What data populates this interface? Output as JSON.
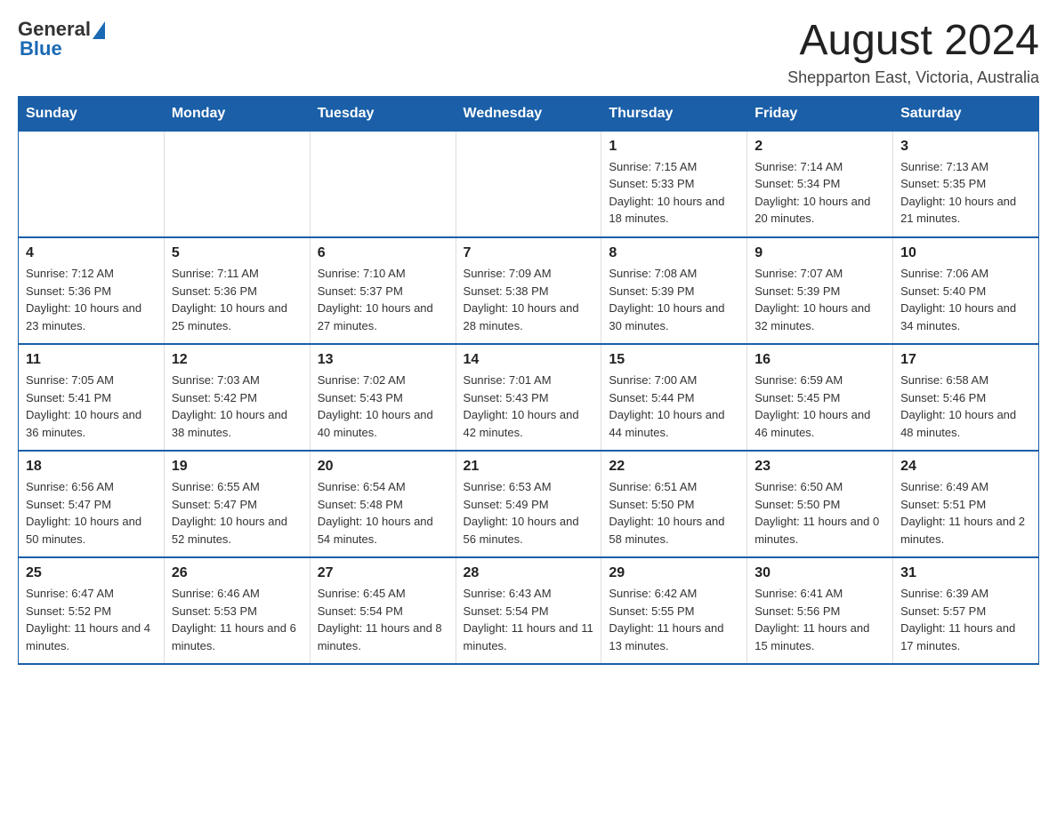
{
  "header": {
    "logo": {
      "text_general": "General",
      "text_blue": "Blue",
      "triangle_color": "#1a69b5"
    },
    "title": "August 2024",
    "location": "Shepparton East, Victoria, Australia"
  },
  "days_of_week": [
    "Sunday",
    "Monday",
    "Tuesday",
    "Wednesday",
    "Thursday",
    "Friday",
    "Saturday"
  ],
  "weeks": [
    {
      "days": [
        {
          "date": "",
          "info": ""
        },
        {
          "date": "",
          "info": ""
        },
        {
          "date": "",
          "info": ""
        },
        {
          "date": "",
          "info": ""
        },
        {
          "date": "1",
          "info": "Sunrise: 7:15 AM\nSunset: 5:33 PM\nDaylight: 10 hours and 18 minutes."
        },
        {
          "date": "2",
          "info": "Sunrise: 7:14 AM\nSunset: 5:34 PM\nDaylight: 10 hours and 20 minutes."
        },
        {
          "date": "3",
          "info": "Sunrise: 7:13 AM\nSunset: 5:35 PM\nDaylight: 10 hours and 21 minutes."
        }
      ]
    },
    {
      "days": [
        {
          "date": "4",
          "info": "Sunrise: 7:12 AM\nSunset: 5:36 PM\nDaylight: 10 hours and 23 minutes."
        },
        {
          "date": "5",
          "info": "Sunrise: 7:11 AM\nSunset: 5:36 PM\nDaylight: 10 hours and 25 minutes."
        },
        {
          "date": "6",
          "info": "Sunrise: 7:10 AM\nSunset: 5:37 PM\nDaylight: 10 hours and 27 minutes."
        },
        {
          "date": "7",
          "info": "Sunrise: 7:09 AM\nSunset: 5:38 PM\nDaylight: 10 hours and 28 minutes."
        },
        {
          "date": "8",
          "info": "Sunrise: 7:08 AM\nSunset: 5:39 PM\nDaylight: 10 hours and 30 minutes."
        },
        {
          "date": "9",
          "info": "Sunrise: 7:07 AM\nSunset: 5:39 PM\nDaylight: 10 hours and 32 minutes."
        },
        {
          "date": "10",
          "info": "Sunrise: 7:06 AM\nSunset: 5:40 PM\nDaylight: 10 hours and 34 minutes."
        }
      ]
    },
    {
      "days": [
        {
          "date": "11",
          "info": "Sunrise: 7:05 AM\nSunset: 5:41 PM\nDaylight: 10 hours and 36 minutes."
        },
        {
          "date": "12",
          "info": "Sunrise: 7:03 AM\nSunset: 5:42 PM\nDaylight: 10 hours and 38 minutes."
        },
        {
          "date": "13",
          "info": "Sunrise: 7:02 AM\nSunset: 5:43 PM\nDaylight: 10 hours and 40 minutes."
        },
        {
          "date": "14",
          "info": "Sunrise: 7:01 AM\nSunset: 5:43 PM\nDaylight: 10 hours and 42 minutes."
        },
        {
          "date": "15",
          "info": "Sunrise: 7:00 AM\nSunset: 5:44 PM\nDaylight: 10 hours and 44 minutes."
        },
        {
          "date": "16",
          "info": "Sunrise: 6:59 AM\nSunset: 5:45 PM\nDaylight: 10 hours and 46 minutes."
        },
        {
          "date": "17",
          "info": "Sunrise: 6:58 AM\nSunset: 5:46 PM\nDaylight: 10 hours and 48 minutes."
        }
      ]
    },
    {
      "days": [
        {
          "date": "18",
          "info": "Sunrise: 6:56 AM\nSunset: 5:47 PM\nDaylight: 10 hours and 50 minutes."
        },
        {
          "date": "19",
          "info": "Sunrise: 6:55 AM\nSunset: 5:47 PM\nDaylight: 10 hours and 52 minutes."
        },
        {
          "date": "20",
          "info": "Sunrise: 6:54 AM\nSunset: 5:48 PM\nDaylight: 10 hours and 54 minutes."
        },
        {
          "date": "21",
          "info": "Sunrise: 6:53 AM\nSunset: 5:49 PM\nDaylight: 10 hours and 56 minutes."
        },
        {
          "date": "22",
          "info": "Sunrise: 6:51 AM\nSunset: 5:50 PM\nDaylight: 10 hours and 58 minutes."
        },
        {
          "date": "23",
          "info": "Sunrise: 6:50 AM\nSunset: 5:50 PM\nDaylight: 11 hours and 0 minutes."
        },
        {
          "date": "24",
          "info": "Sunrise: 6:49 AM\nSunset: 5:51 PM\nDaylight: 11 hours and 2 minutes."
        }
      ]
    },
    {
      "days": [
        {
          "date": "25",
          "info": "Sunrise: 6:47 AM\nSunset: 5:52 PM\nDaylight: 11 hours and 4 minutes."
        },
        {
          "date": "26",
          "info": "Sunrise: 6:46 AM\nSunset: 5:53 PM\nDaylight: 11 hours and 6 minutes."
        },
        {
          "date": "27",
          "info": "Sunrise: 6:45 AM\nSunset: 5:54 PM\nDaylight: 11 hours and 8 minutes."
        },
        {
          "date": "28",
          "info": "Sunrise: 6:43 AM\nSunset: 5:54 PM\nDaylight: 11 hours and 11 minutes."
        },
        {
          "date": "29",
          "info": "Sunrise: 6:42 AM\nSunset: 5:55 PM\nDaylight: 11 hours and 13 minutes."
        },
        {
          "date": "30",
          "info": "Sunrise: 6:41 AM\nSunset: 5:56 PM\nDaylight: 11 hours and 15 minutes."
        },
        {
          "date": "31",
          "info": "Sunrise: 6:39 AM\nSunset: 5:57 PM\nDaylight: 11 hours and 17 minutes."
        }
      ]
    }
  ]
}
